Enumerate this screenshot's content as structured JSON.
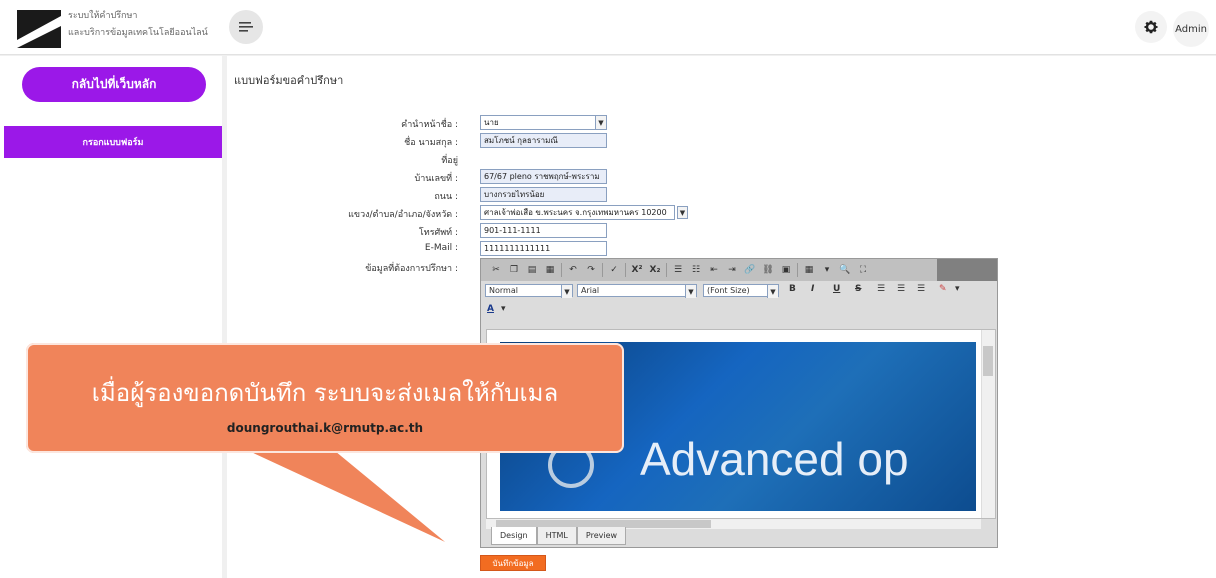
{
  "header": {
    "brand_line1": "ระบบให้คำปรึกษา",
    "brand_line2": "และบริการข้อมูลเทคโนโลยีออนไลน์",
    "admin_label": "Admin"
  },
  "sidebar": {
    "back_button": "กลับไปที่เว็บหลัก",
    "items": [
      {
        "label": "กรอกแบบฟอร์ม"
      }
    ]
  },
  "main": {
    "title": "แบบฟอร์มขอคำปรึกษา",
    "fields": {
      "prefix": {
        "label": "คำนำหน้าชื่อ :",
        "value": "นาย"
      },
      "fullname": {
        "label": "ชื่อ นามสกุล :",
        "value": "สมโภชน์ กุลธารามณี"
      },
      "address": {
        "label": "ที่อยู่"
      },
      "house_no": {
        "label": "บ้านเลขที่ :",
        "value": "67/67 pleno ราชพฤกษ์-พระราม"
      },
      "road": {
        "label": "ถนน :",
        "value": "บางกรวยไทรน้อย"
      },
      "district": {
        "label": "แขวง/ตำบล/อำเภอ/จังหวัด :",
        "value": "ศาลเจ้าพ่อเสือ ข.พระนคร จ.กรุงเทพมหานคร 10200"
      },
      "phone": {
        "label": "โทรศัพท์ :",
        "value": "901-111-1111"
      },
      "email": {
        "label": "E-Mail :",
        "value": "1111111111111"
      },
      "consult": {
        "label": "ข้อมูลที่ต้องการปรึกษา :"
      }
    },
    "editor": {
      "format": "Normal",
      "font": "Arial",
      "size": "(Font Size)",
      "image_text": "Advanced op",
      "tabs": [
        "Design",
        "HTML",
        "Preview"
      ]
    },
    "save_button": "บันทึกข้อมูล"
  },
  "callout": {
    "title": "เมื่อผู้รองขอกดบันทึก ระบบจะส่งเมลให้กับเมล",
    "email": "doungrouthai.k@rmutp.ac.th",
    "color": "#f0845a"
  },
  "colors": {
    "accent": "#9b18e8",
    "save": "#f26c21"
  }
}
